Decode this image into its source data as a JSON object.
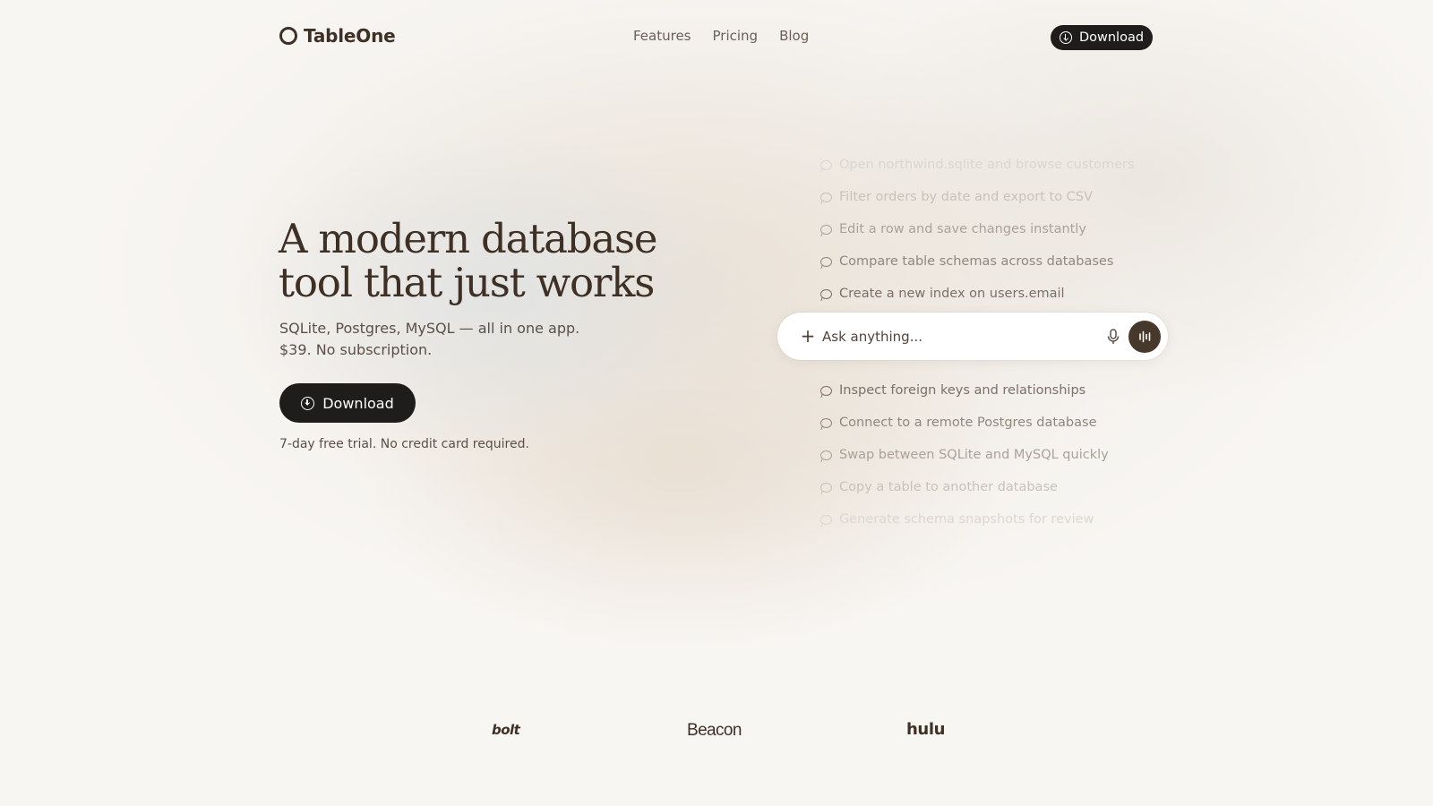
{
  "header": {
    "brand": "TableOne",
    "nav": [
      "Features",
      "Pricing",
      "Blog"
    ],
    "download_label": "Download"
  },
  "hero": {
    "title": "A modern database tool that just works",
    "subtitle_line1": "SQLite, Postgres, MySQL — all in one app.",
    "subtitle_line2": "$39. No subscription.",
    "download_label": "Download",
    "note": "7-day free trial. No credit card required."
  },
  "suggestions_top": [
    "Open northwind.sqlite and browse customers",
    "Filter orders by date and export to CSV",
    "Edit a row and save changes instantly",
    "Compare table schemas across databases",
    "Create a new index on users.email"
  ],
  "suggestions_bottom": [
    "Inspect foreign keys and relationships",
    "Connect to a remote Postgres database",
    "Swap between SQLite and MySQL quickly",
    "Copy a table to another database",
    "Generate schema snapshots for review"
  ],
  "ask": {
    "placeholder": "Ask anything..."
  },
  "logos": [
    "bolt",
    "Beacon",
    "hulu"
  ],
  "icons": {
    "download": "download-circle-icon",
    "suggestion": "chat-bubble-icon",
    "plus": "plus-icon",
    "mic": "microphone-icon",
    "voice": "voice-waveform-icon"
  },
  "colors": {
    "accent_dark": "#1f1d1b",
    "brand_brown": "#3e3025",
    "background": "#f8f6f3"
  }
}
